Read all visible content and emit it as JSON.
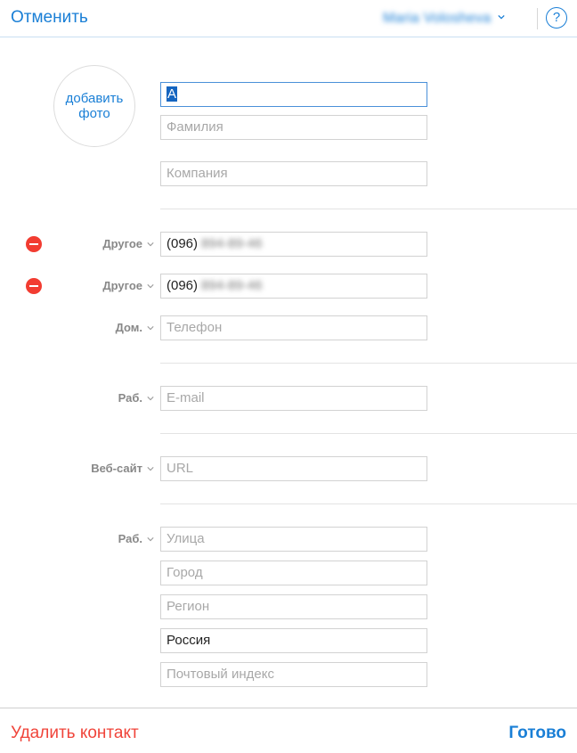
{
  "header": {
    "cancel_label": "Отменить",
    "account_name": "Maria Volosheva",
    "help_label": "?"
  },
  "photo": {
    "add_label": "добавить фото"
  },
  "name": {
    "first_value": "А",
    "last_placeholder": "Фамилия",
    "company_placeholder": "Компания"
  },
  "phones": [
    {
      "label": "Другое",
      "prefix": "(096)",
      "number": "894-89-46"
    },
    {
      "label": "Другое",
      "prefix": "(096)",
      "number": "894-89-46"
    },
    {
      "label": "Дом.",
      "placeholder": "Телефон"
    }
  ],
  "email": {
    "label": "Раб.",
    "placeholder": "E-mail"
  },
  "website": {
    "label": "Веб-сайт",
    "placeholder": "URL"
  },
  "address": {
    "label": "Раб.",
    "street_placeholder": "Улица",
    "city_placeholder": "Город",
    "region_placeholder": "Регион",
    "country_value": "Россия",
    "postal_placeholder": "Почтовый индекс"
  },
  "footer": {
    "delete_label": "Удалить контакт",
    "done_label": "Готово"
  },
  "colors": {
    "accent": "#1a7fd6",
    "destructive": "#f0443a",
    "delete_badge": "#f23c31"
  }
}
